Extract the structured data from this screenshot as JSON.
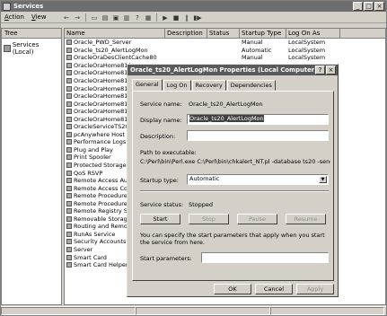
{
  "window": {
    "title": "Services"
  },
  "menu": [
    "Action",
    "View"
  ],
  "toolbar": {
    "icons": [
      "back",
      "forward",
      "up",
      "properties",
      "export",
      "help",
      "help2",
      "play",
      "stop",
      "pause",
      "restart"
    ]
  },
  "tree": {
    "header": "Tree",
    "item": "Services (Local)"
  },
  "list": {
    "columns": [
      "Name",
      "Description",
      "Status",
      "Startup Type",
      "Log On As"
    ],
    "rows": [
      {
        "name": "Oracle_PWD_Server",
        "desc": "",
        "status": "",
        "startup": "Manual",
        "logon": "LocalSystem"
      },
      {
        "name": "Oracle_ts20_AlertLogMon",
        "desc": "",
        "status": "",
        "startup": "Automatic",
        "logon": "LocalSystem"
      },
      {
        "name": "OracleOraDesClientCache80",
        "desc": "",
        "status": "",
        "startup": "Manual",
        "logon": "LocalSystem"
      },
      {
        "name": "OracleOraHome81Ag",
        "desc": "",
        "status": "",
        "startup": "",
        "logon": ""
      },
      {
        "name": "OracleOraHome81Cli",
        "desc": "",
        "status": "",
        "startup": "",
        "logon": ""
      },
      {
        "name": "OracleOraHome81Cm",
        "desc": "",
        "status": "",
        "startup": "",
        "logon": ""
      },
      {
        "name": "OracleOraHome81Da",
        "desc": "",
        "status": "",
        "startup": "",
        "logon": ""
      },
      {
        "name": "OracleOraHome81HT",
        "desc": "",
        "status": "",
        "startup": "",
        "logon": ""
      },
      {
        "name": "OracleOraHome81Ma",
        "desc": "",
        "status": "",
        "startup": "",
        "logon": ""
      },
      {
        "name": "OracleOraHome81Pa",
        "desc": "",
        "status": "",
        "startup": "",
        "logon": ""
      },
      {
        "name": "OracleOraHome81TN",
        "desc": "",
        "status": "",
        "startup": "",
        "logon": ""
      },
      {
        "name": "OracleServiceTS20",
        "desc": "",
        "status": "",
        "startup": "",
        "logon": ""
      },
      {
        "name": "pcAnywhere Host Se",
        "desc": "",
        "status": "",
        "startup": "",
        "logon": ""
      },
      {
        "name": "Performance Logs ar",
        "desc": "",
        "status": "",
        "startup": "",
        "logon": ""
      },
      {
        "name": "Plug and Play",
        "desc": "",
        "status": "",
        "startup": "",
        "logon": ""
      },
      {
        "name": "Print Spooler",
        "desc": "",
        "status": "",
        "startup": "",
        "logon": ""
      },
      {
        "name": "Protected Storage",
        "desc": "",
        "status": "",
        "startup": "",
        "logon": ""
      },
      {
        "name": "QoS RSVP",
        "desc": "",
        "status": "",
        "startup": "",
        "logon": ""
      },
      {
        "name": "Remote Access Auto",
        "desc": "",
        "status": "",
        "startup": "",
        "logon": ""
      },
      {
        "name": "Remote Access Conn",
        "desc": "",
        "status": "",
        "startup": "",
        "logon": ""
      },
      {
        "name": "Remote Procedure C",
        "desc": "",
        "status": "",
        "startup": "",
        "logon": ""
      },
      {
        "name": "Remote Procedure C",
        "desc": "",
        "status": "",
        "startup": "",
        "logon": ""
      },
      {
        "name": "Remote Registry Ser",
        "desc": "",
        "status": "",
        "startup": "",
        "logon": ""
      },
      {
        "name": "Removable Storage",
        "desc": "",
        "status": "",
        "startup": "",
        "logon": ""
      },
      {
        "name": "Routing and Remote",
        "desc": "",
        "status": "",
        "startup": "",
        "logon": ""
      },
      {
        "name": "RunAs Service",
        "desc": "",
        "status": "",
        "startup": "",
        "logon": ""
      },
      {
        "name": "Security Accounts M",
        "desc": "",
        "status": "",
        "startup": "",
        "logon": ""
      },
      {
        "name": "Server",
        "desc": "",
        "status": "",
        "startup": "",
        "logon": ""
      },
      {
        "name": "Smart Card",
        "desc": "",
        "status": "",
        "startup": "",
        "logon": ""
      },
      {
        "name": "Smart Card Helper",
        "desc": "Provides s...",
        "status": "",
        "startup": "Manual",
        "logon": "LocalSystem"
      }
    ]
  },
  "dialog": {
    "title": "Oracle_ts20_AlertLogMon Properties (Local Computer)",
    "tabs": [
      "General",
      "Log On",
      "Recovery",
      "Dependencies"
    ],
    "service_name_label": "Service name:",
    "service_name_value": "Oracle_ts20_AlertLogMon",
    "display_name_label": "Display name:",
    "display_name_value": "Oracle_ts20_AlertLogMon",
    "description_label": "Description:",
    "description_value": "",
    "path_label": "Path to executable:",
    "path_value": "C:\\Perl\\bin\\Perl.exe C:\\Perl\\bin\\chkalert_NT.pl -database ts20 -sendmail -l",
    "startup_label": "Startup type:",
    "startup_value": "Automatic",
    "status_label": "Service status:",
    "status_value": "Stopped",
    "btn_start": "Start",
    "btn_stop": "Stop",
    "btn_pause": "Pause",
    "btn_resume": "Resume",
    "hint": "You can specify the start parameters that apply when you start the service from here.",
    "params_label": "Start parameters:",
    "params_value": "",
    "ok": "OK",
    "cancel": "Cancel",
    "apply": "Apply"
  }
}
